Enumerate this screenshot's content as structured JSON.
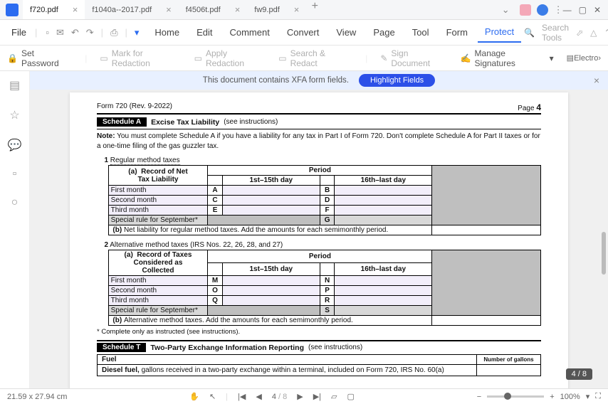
{
  "app": {
    "tabs": [
      "f720.pdf",
      "f1040a--2017.pdf",
      "f4506t.pdf",
      "fw9.pdf"
    ]
  },
  "menu": {
    "file": "File",
    "items": [
      "Home",
      "Edit",
      "Comment",
      "Convert",
      "View",
      "Page",
      "Tool",
      "Form",
      "Protect"
    ],
    "active": 8,
    "search": "Search Tools"
  },
  "toolbar": {
    "set_password": "Set Password",
    "mark": "Mark for Redaction",
    "apply": "Apply Redaction",
    "search_redact": "Search & Redact",
    "sign": "Sign Document",
    "manage": "Manage Signatures",
    "electro": "Electro"
  },
  "banner": {
    "msg": "This document contains XFA form fields.",
    "btn": "Highlight Fields"
  },
  "pdf": {
    "form_rev": "Form 720 (Rev. 9-2022)",
    "page_label": "Page",
    "page_num": "4",
    "schedA": {
      "badge": "Schedule A",
      "title": "Excise Tax Liability",
      "instr": "(see instructions)"
    },
    "note_b": "Note:",
    "note": "You must complete Schedule A if you have a liability for any tax in Part I of Form 720. Don't complete Schedule A for Part II taxes or for a one-time filing of the gas guzzler tax.",
    "line1": "Regular method taxes",
    "recordA_a": "(a)",
    "recordA_title1": "Record of Net",
    "recordA_title2": "Tax Liability",
    "period": "Period",
    "p1": "1st–15th day",
    "p2": "16th–last day",
    "rows1": [
      "First month",
      "Second month",
      "Third month",
      "Special rule for September*"
    ],
    "letters1a": [
      "A",
      "C",
      "E",
      ""
    ],
    "letters1b": [
      "B",
      "D",
      "F",
      "G"
    ],
    "sub_b": "(b)",
    "sub1": "Net liability for regular method taxes. Add the amounts for each semimonthly period.",
    "line2": "Alternative method taxes (IRS Nos. 22, 26, 28, and 27)",
    "recordB_title1": "Record of Taxes",
    "recordB_title2": "Considered as",
    "recordB_title3": "Collected",
    "rows2": [
      "First month",
      "Second month",
      "Third month",
      "Special rule for September*"
    ],
    "letters2a": [
      "M",
      "O",
      "Q",
      ""
    ],
    "letters2b": [
      "N",
      "P",
      "R",
      "S"
    ],
    "sub2": "Alternative method taxes. Add the amounts for each semimonthly period.",
    "footnote": "* Complete only as instructed (see instructions).",
    "schedT": {
      "badge": "Schedule T",
      "title": "Two-Party Exchange Information Reporting",
      "instr": "(see instructions)"
    },
    "fuel": "Fuel",
    "ngallons": "Number of gallons",
    "diesel": "Diesel fuel,",
    "diesel_rest": " gallons received in a two-party exchange within a terminal, included on Form 720, IRS No. 60(a)"
  },
  "pagebadge": "4 / 8",
  "status": {
    "dims": "21.59 x 27.94 cm",
    "page": "4",
    "pages": "/ 8",
    "zoom": "100%"
  }
}
